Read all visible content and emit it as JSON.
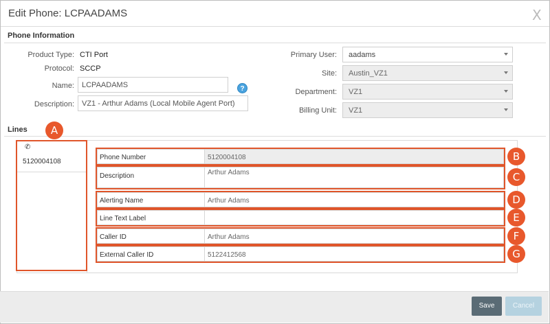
{
  "dialog": {
    "title": "Edit Phone: LCPAADAMS",
    "close_glyph": "X"
  },
  "phone_info": {
    "section_title": "Phone Information",
    "product_type": {
      "label": "Product Type:",
      "value": "CTI Port"
    },
    "protocol": {
      "label": "Protocol:",
      "value": "SCCP"
    },
    "name": {
      "label": "Name:",
      "value": "LCPAADAMS"
    },
    "description": {
      "label": "Description:",
      "value": "VZ1 - Arthur Adams (Local Mobile Agent Port)"
    },
    "help_glyph": "?",
    "primary_user": {
      "label": "Primary User:",
      "value": "aadams"
    },
    "site": {
      "label": "Site:",
      "value": "Austin_VZ1"
    },
    "department": {
      "label": "Department:",
      "value": "VZ1"
    },
    "billing_unit": {
      "label": "Billing Unit:",
      "value": "VZ1"
    }
  },
  "lines": {
    "section_title": "Lines",
    "tabs": [
      {
        "number": "5120004108",
        "icon": "phone-icon"
      }
    ],
    "fields": {
      "phone_number": {
        "label": "Phone Number",
        "value": "5120004108"
      },
      "description": {
        "label": "Description",
        "value": "Arthur Adams"
      },
      "alerting_name": {
        "label": "Alerting Name",
        "value": "Arthur Adams"
      },
      "line_text_label": {
        "label": "Line Text Label",
        "value": ""
      },
      "caller_id": {
        "label": "Caller ID",
        "value": "Arthur Adams"
      },
      "external_caller_id": {
        "label": "External Caller ID",
        "value": "5122412568"
      }
    }
  },
  "callouts": {
    "a": "A",
    "b": "B",
    "c": "C",
    "d": "D",
    "e": "E",
    "f": "F",
    "g": "G"
  },
  "footer": {
    "save_label": "Save",
    "cancel_label": "Cancel"
  },
  "colors": {
    "callout": "#e8582c",
    "save_button": "#5a6b75",
    "cancel_button": "#b5d2e0"
  }
}
